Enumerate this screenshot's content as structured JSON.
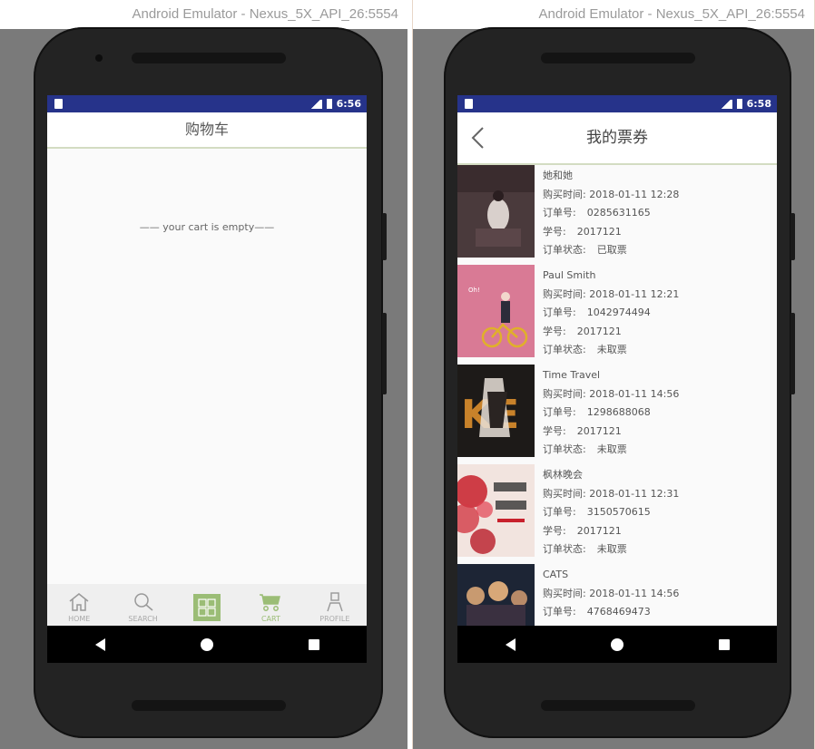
{
  "left_window": {
    "title": "Android Emulator - Nexus_5X_API_26:5554",
    "status_time": "6:56",
    "page_title": "购物车",
    "empty_message": "—— your cart is empty——",
    "tabs": [
      {
        "label": "HOME",
        "icon": "home-icon"
      },
      {
        "label": "SEARCH",
        "icon": "search-icon"
      },
      {
        "label": "",
        "icon": "grid-icon"
      },
      {
        "label": "CART",
        "icon": "cart-icon"
      },
      {
        "label": "PROFILE",
        "icon": "profile-icon"
      }
    ]
  },
  "right_window": {
    "title": "Android Emulator - Nexus_5X_API_26:5554",
    "status_time": "6:58",
    "page_title": "我的票券",
    "tickets": [
      {
        "name": "她和她",
        "purchase_time": "购买时间: 2018-01-11 12:28",
        "order_label": "订单号:",
        "order_no": "0285631165",
        "student_label": "学号:",
        "student_id": "2017121",
        "status_label": "订单状态:",
        "status": "已取票",
        "poster_color": "#4a3a3c"
      },
      {
        "name": "Paul Smith",
        "purchase_time": "购买时间: 2018-01-11 12:21",
        "order_label": "订单号:",
        "order_no": "1042974494",
        "student_label": "学号:",
        "student_id": "2017121",
        "status_label": "订单状态:",
        "status": "未取票",
        "poster_color": "#d97a95"
      },
      {
        "name": "Time Travel",
        "purchase_time": "购买时间: 2018-01-11 14:56",
        "order_label": "订单号:",
        "order_no": "1298688068",
        "student_label": "学号:",
        "student_id": "2017121",
        "status_label": "订单状态:",
        "status": "未取票",
        "poster_color": "#1d1a18"
      },
      {
        "name": "枫林晚会",
        "purchase_time": "购买时间: 2018-01-11 12:31",
        "order_label": "订单号:",
        "order_no": "3150570615",
        "student_label": "学号:",
        "student_id": "2017121",
        "status_label": "订单状态:",
        "status": "未取票",
        "poster_color": "#f2e4df"
      },
      {
        "name": "CATS",
        "purchase_time": "购买时间: 2018-01-11 14:56",
        "order_label": "订单号:",
        "order_no": "4768469473",
        "student_label": "",
        "student_id": "",
        "status_label": "",
        "status": "",
        "poster_color": "#1d2535"
      }
    ]
  },
  "colors": {
    "status_bar": "#26338a",
    "accent_green": "#9bbd76",
    "divider": "#d3dcc2"
  }
}
